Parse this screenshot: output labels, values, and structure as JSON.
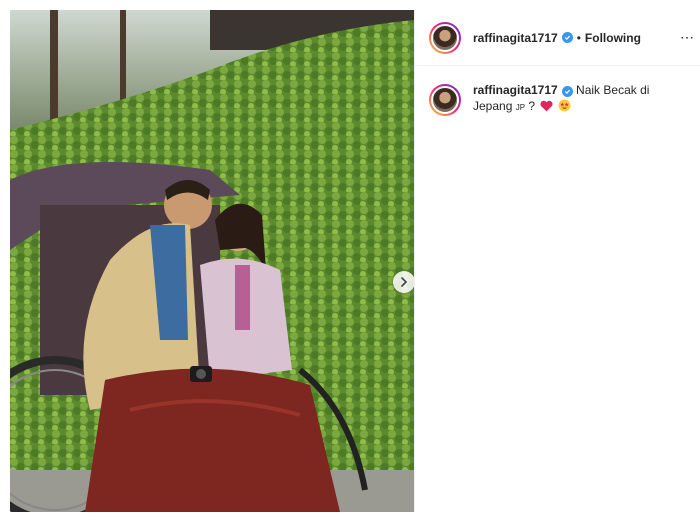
{
  "post": {
    "username": "raffinagita1717",
    "separator": "•",
    "follow_status": "Following",
    "caption": {
      "text_part1": "Naik Becak di Jepang",
      "flag_text": "JP",
      "text_part2": "?"
    }
  },
  "icons": {
    "verified": "verified-badge-icon",
    "next": "chevron-right-icon",
    "more": "more-options-icon",
    "heart": "red-heart-emoji",
    "star_eyes": "star-struck-emoji"
  },
  "colors": {
    "verified_blue": "#3897f0",
    "heart_red": "#e0245e"
  }
}
